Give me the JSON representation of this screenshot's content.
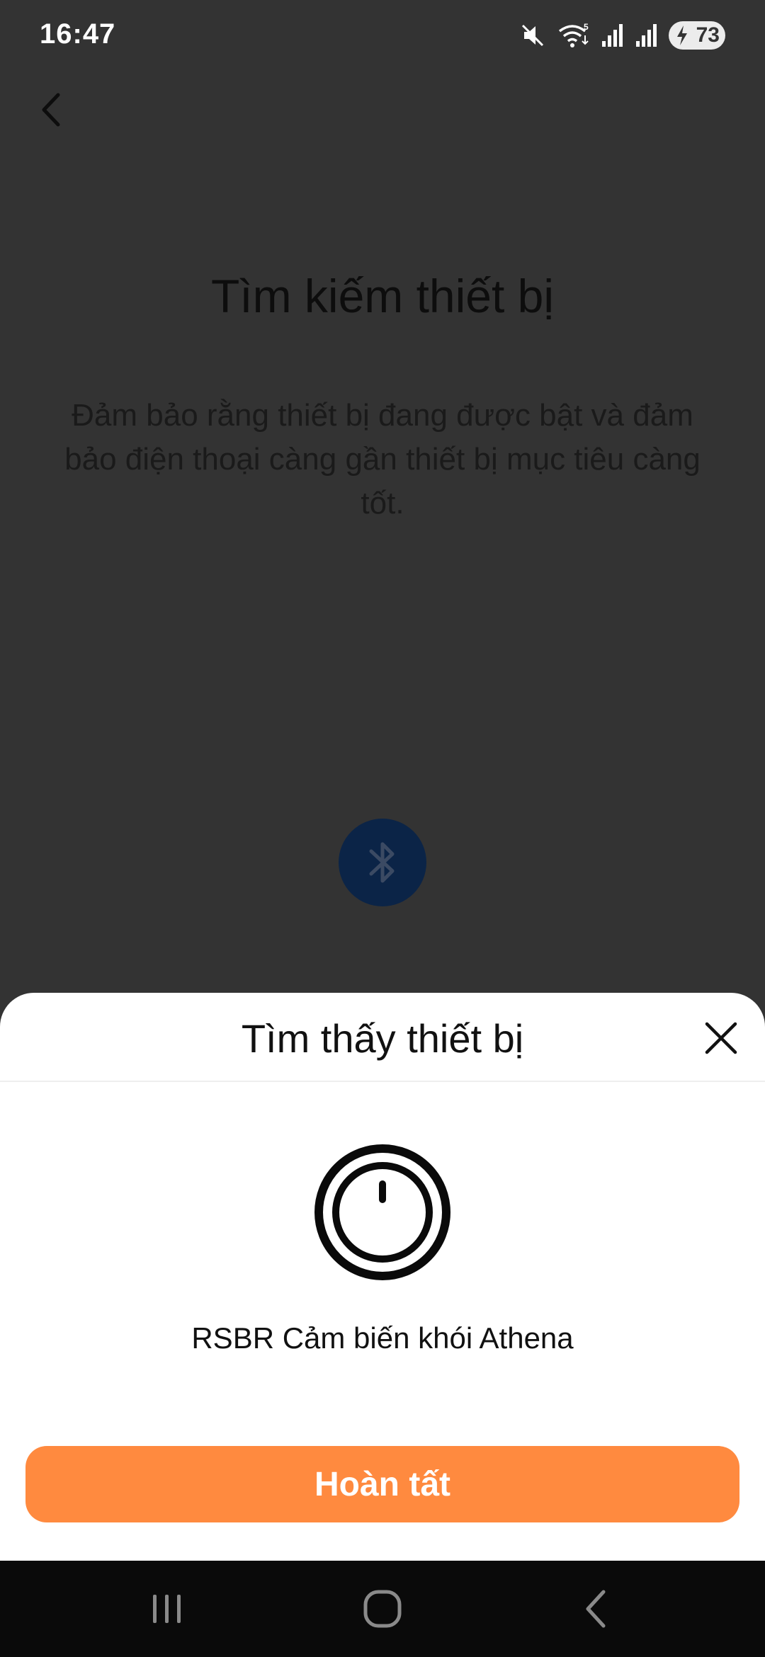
{
  "status_bar": {
    "time": "16:47",
    "battery": "73",
    "icons": [
      "mute-icon",
      "wifi-icon",
      "signal-icon",
      "signal-icon",
      "battery-icon"
    ]
  },
  "page": {
    "title": "Tìm kiếm thiết bị",
    "description": "Đảm bảo rằng thiết bị đang được bật và đảm bảo điện thoại càng gần thiết bị mục tiêu càng tốt."
  },
  "sheet": {
    "title": "Tìm thấy thiết bị",
    "device_name": "RSBR Cảm biến khói Athena",
    "done_label": "Hoàn tất"
  },
  "colors": {
    "background_dimmed": "#333333",
    "accent": "#ff8a3f",
    "bluetooth_circle": "#0b2447",
    "sheet": "#ffffff"
  }
}
